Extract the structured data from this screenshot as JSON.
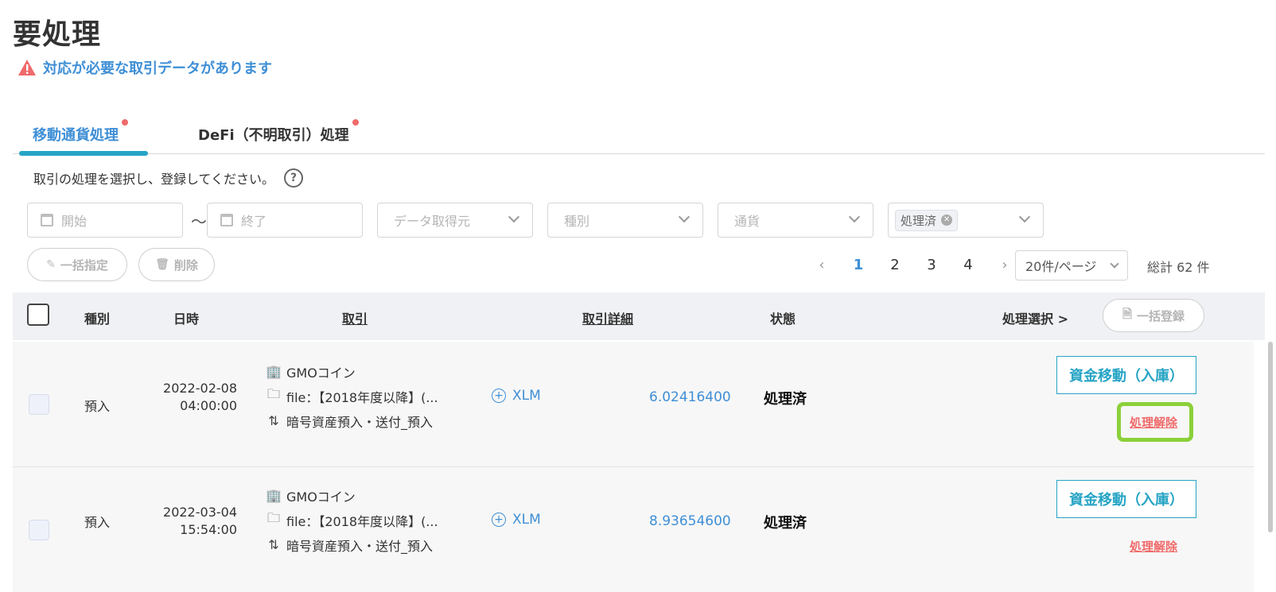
{
  "page": {
    "title": "要処理",
    "alert": "対応が必要な取引データがあります"
  },
  "tabs": [
    {
      "label": "移動通貨処理",
      "active": true,
      "has_dot": true
    },
    {
      "label": "DeFi（不明取引）処理",
      "active": false,
      "has_dot": true
    }
  ],
  "instruction": "取引の処理を選択し、登録してください。",
  "help_icon_text": "?",
  "filters": {
    "start_placeholder": "開始",
    "separator": "〜",
    "end_placeholder": "終了",
    "source_placeholder": "データ取得元",
    "type_placeholder": "種別",
    "currency_placeholder": "通貨",
    "status_tag": "処理済"
  },
  "actions": {
    "bulk_assign": "一括指定",
    "delete": "削除",
    "bulk_register": "一括登録"
  },
  "pagination": {
    "pages": [
      "1",
      "2",
      "3",
      "4"
    ],
    "current": "1",
    "prev_icon": "chevron-left",
    "next_icon": "chevron-right",
    "page_size": "20件/ページ",
    "total": "総計 62 件"
  },
  "table": {
    "headers": {
      "type": "種別",
      "datetime": "日時",
      "transaction": "取引",
      "detail": "取引詳細",
      "status": "状態",
      "action": "処理選択 >"
    },
    "rows": [
      {
        "type": "預入",
        "date": "2022-02-08",
        "time": "04:00:00",
        "exchange": "GMOコイン",
        "file": "file：【2018年度以降】(...",
        "kind": "暗号資産預入・送付_預入",
        "currency": "XLM",
        "amount": "6.02416400",
        "status": "処理済",
        "move_button": "資金移動（入庫）",
        "unlink": "処理解除",
        "highlighted": true
      },
      {
        "type": "預入",
        "date": "2022-03-04",
        "time": "15:54:00",
        "exchange": "GMOコイン",
        "file": "file：【2018年度以降】(...",
        "kind": "暗号資産預入・送付_預入",
        "currency": "XLM",
        "amount": "8.93654600",
        "status": "処理済",
        "move_button": "資金移動（入庫）",
        "unlink": "処理解除",
        "highlighted": false
      }
    ]
  },
  "colors": {
    "accent": "#3f8fd6",
    "teal": "#26a4c4",
    "alert_red": "#f06a6a",
    "highlight_green": "#8bd03a"
  }
}
